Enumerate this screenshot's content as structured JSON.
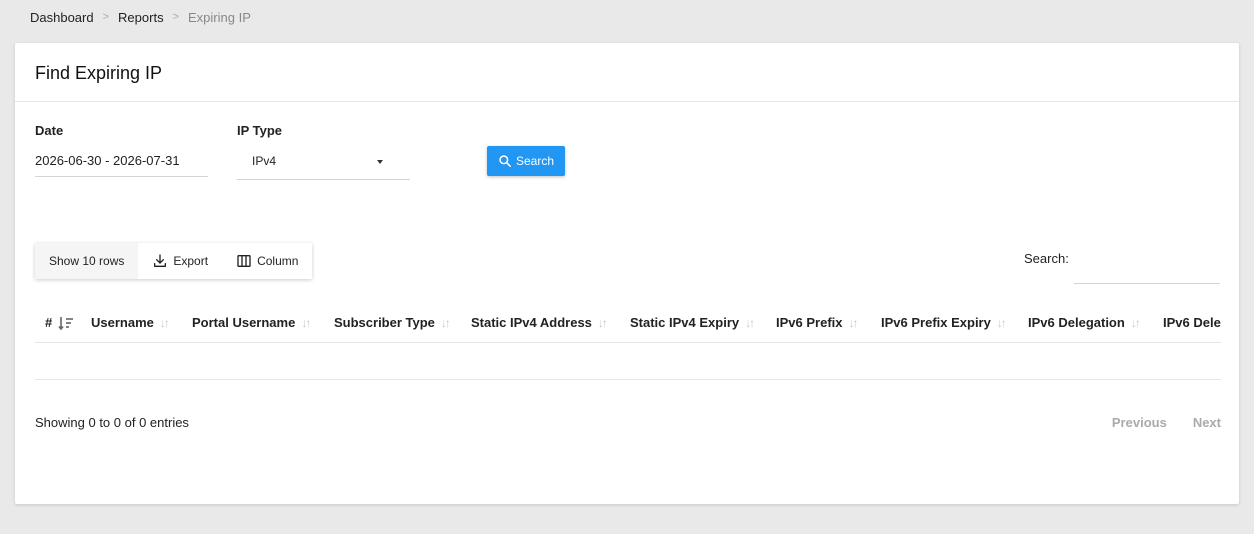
{
  "breadcrumb": {
    "items": [
      "Dashboard",
      "Reports"
    ],
    "separator": ">",
    "current": "Expiring IP"
  },
  "card": {
    "title": "Find Expiring IP"
  },
  "filters": {
    "date_label": "Date",
    "date_value": "2026-06-30 - 2026-07-31",
    "iptype_label": "IP Type",
    "iptype_value": "IPv4",
    "search_button": "Search"
  },
  "toolbar": {
    "show_rows": "Show 10 rows",
    "export": "Export",
    "column": "Column"
  },
  "table_search": {
    "label": "Search:",
    "value": ""
  },
  "table": {
    "columns": [
      "#",
      "Username",
      "Portal Username",
      "Subscriber Type",
      "Static IPv4 Address",
      "Static IPv4 Expiry",
      "IPv6 Prefix",
      "IPv6 Prefix Expiry",
      "IPv6 Delegation",
      "IPv6 Dele"
    ],
    "rows": []
  },
  "footer": {
    "info": "Showing 0 to 0 of 0 entries",
    "previous": "Previous",
    "next": "Next"
  },
  "colors": {
    "accent": "#2196f3",
    "background": "#e9e9e9",
    "card": "#ffffff"
  }
}
